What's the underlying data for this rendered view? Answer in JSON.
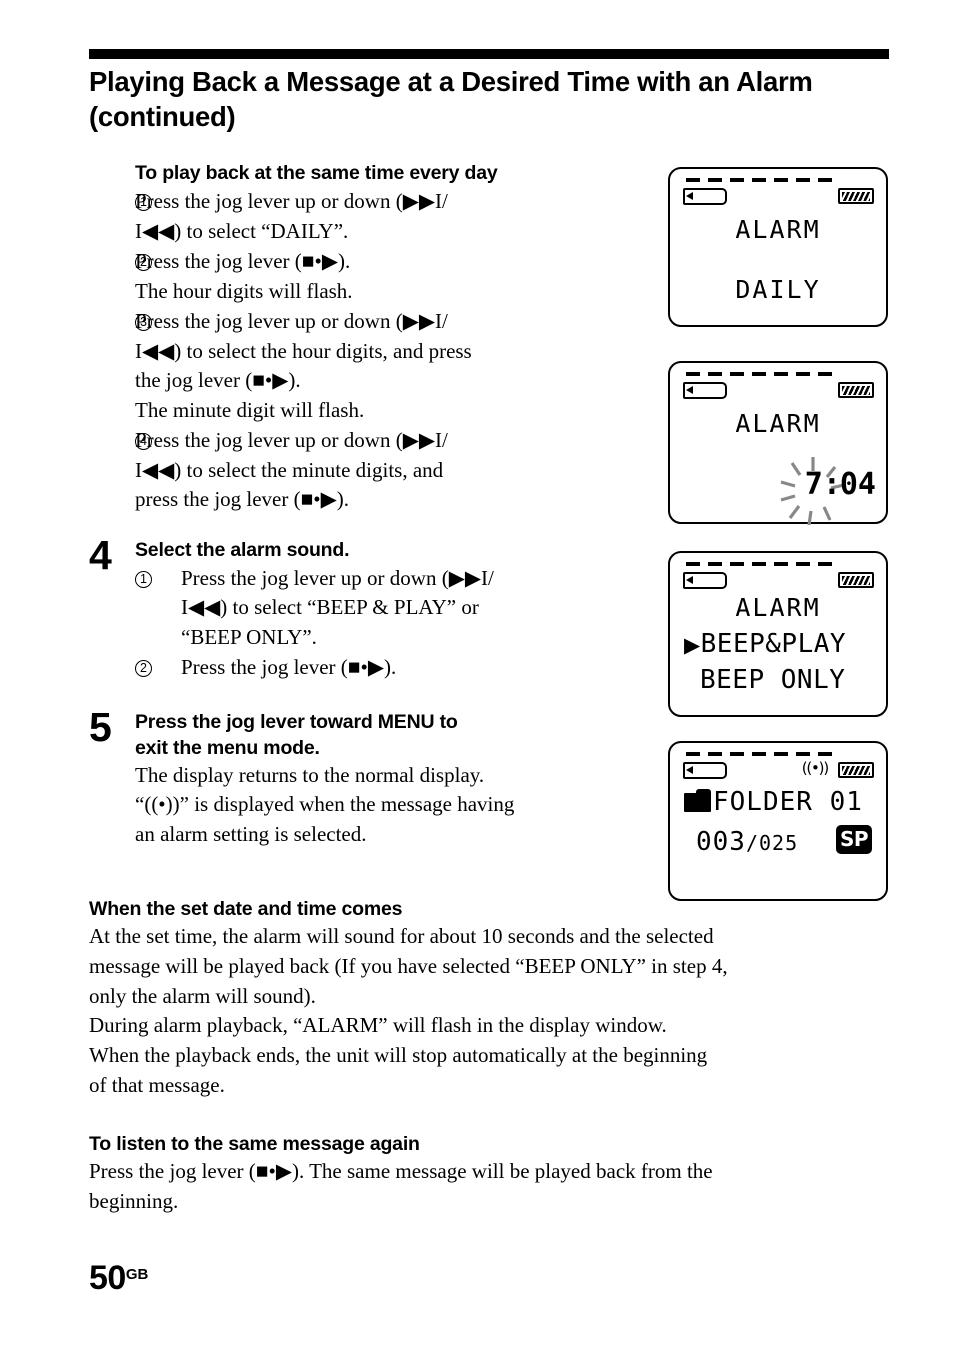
{
  "document": {
    "title": "Playing Back a Message at a Desired Time with an Alarm (continued)",
    "page_number": "50",
    "page_suffix": "GB"
  },
  "sections": {
    "daily": {
      "heading": "To play back at the same time every day",
      "steps": [
        {
          "marker": "1",
          "line1": "Press the jog lever up or down (▶▶I/",
          "line2": "I◀◀) to select “DAILY”."
        },
        {
          "marker": "2",
          "line1": "Press the jog lever (■•▶).",
          "note": "The hour digits will flash."
        },
        {
          "marker": "3",
          "line1": "Press the jog lever up or down (▶▶I/",
          "line2": "I◀◀) to select the hour digits, and press",
          "line3": "the jog lever (■•▶).",
          "note": "The minute digit will flash."
        },
        {
          "marker": "4",
          "line1": "Press the jog lever up or down (▶▶I/",
          "line2": "I◀◀) to select the minute digits, and",
          "line3": "press the jog lever (■•▶)."
        }
      ]
    },
    "step4": {
      "number": "4",
      "title": "Select the alarm sound.",
      "steps": [
        {
          "marker": "1",
          "line1": "Press the jog lever up or down (▶▶I/",
          "line2": "I◀◀) to select “BEEP & PLAY” or",
          "line3": "“BEEP ONLY”."
        },
        {
          "marker": "2",
          "line1": "Press the jog lever (■•▶)."
        }
      ]
    },
    "step5": {
      "number": "5",
      "title_line1": "Press the jog lever toward MENU to",
      "title_line2": "exit the menu mode.",
      "note_line1": "The display returns to the normal display.",
      "note_line2": "“((•))” is displayed when the message having",
      "note_line3": "an alarm setting is selected."
    },
    "when_set": {
      "heading": "When the set date and time comes",
      "line1": "At the set time, the alarm will sound for about 10 seconds and the selected",
      "line2": "message will be played back (If you have selected “BEEP ONLY” in step 4,",
      "line3": "only the alarm will sound).",
      "line4": "During alarm playback, “ALARM” will flash in the display window.",
      "line5": "When the playback ends, the unit will stop automatically at the beginning",
      "line6": "of that message."
    },
    "listen_again": {
      "heading": "To listen to the same message again",
      "line1": "Press the jog lever (■•▶). The same message will be played back from the",
      "line2": "beginning."
    }
  },
  "lcd_panels": [
    {
      "id": "panel-alarm-daily",
      "icons": {
        "tape": "tape-icon",
        "battery": "battery-icon"
      },
      "line1": "ALARM",
      "line2": "DAILY"
    },
    {
      "id": "panel-alarm-time",
      "icons": {
        "tape": "tape-icon",
        "battery": "battery-icon"
      },
      "line1": "ALARM",
      "hour": "7",
      "colon": ":",
      "minute": "04",
      "flashing": "hour"
    },
    {
      "id": "panel-alarm-sound",
      "icons": {
        "tape": "tape-icon",
        "battery": "battery-icon"
      },
      "line1": "ALARM",
      "caret": "▶",
      "option1": "BEEP&PLAY",
      "option2": "BEEP ONLY"
    },
    {
      "id": "panel-normal-display",
      "icons": {
        "tape": "tape-icon",
        "battery": "battery-icon",
        "alarm": "((•))",
        "folder": "folder-icon"
      },
      "folder_label": "FOLDER",
      "folder_number": "01",
      "message_current": "003",
      "message_separator": "/",
      "message_total": "025",
      "mode_badge": "SP"
    }
  ]
}
